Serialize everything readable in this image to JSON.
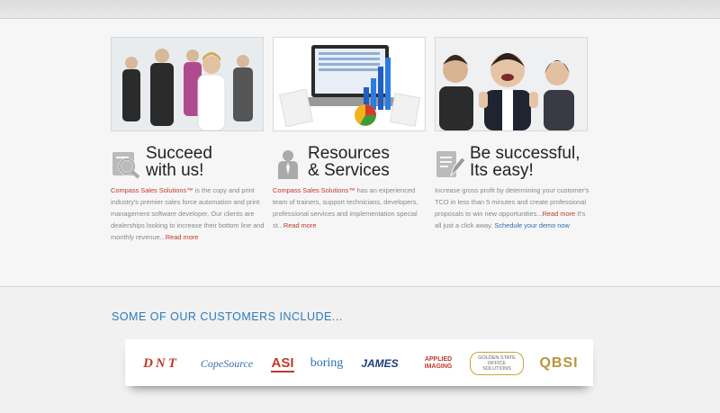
{
  "columns": [
    {
      "title_line1": "Succeed",
      "title_line2": "with us!",
      "icon": "magnifier-document-icon",
      "brand": "Compass Sales Solutions™",
      "text": " is the copy and print industry's premier sales force automation and print management software developer. Our clients are dealerships looking to increase their bottom line and monthly revenue...",
      "link": "Read more"
    },
    {
      "title_line1": "Resources",
      "title_line2": "& Services",
      "icon": "person-icon",
      "brand": "Compass Sales Solutions™",
      "text": " has an experienced team of trainers, support technicians, developers, professional services and implementation special st...",
      "link": "Read more"
    },
    {
      "title_line1": "Be successful,",
      "title_line2": "Its easy!",
      "icon": "document-pen-icon",
      "text": "Increase gross profit by determining your customer's TCO in less than 5 minutes and create professional proposals to win new opportunities...",
      "link": "Read more",
      "text2": " It's all just a click away. ",
      "link2": "Schedule your demo now"
    }
  ],
  "customers": {
    "heading": "SOME OF OUR CUSTOMERS INCLUDE...",
    "logos": [
      "DNT",
      "CopeSource",
      "ASI",
      "boring",
      "JAMES",
      "APPLIED IMAGING",
      "GOLDEN STATE OFFICE SOLUTIONS",
      "QBSI"
    ]
  },
  "colors": {
    "accent_red": "#c0392b",
    "accent_blue": "#2b7bbd"
  }
}
